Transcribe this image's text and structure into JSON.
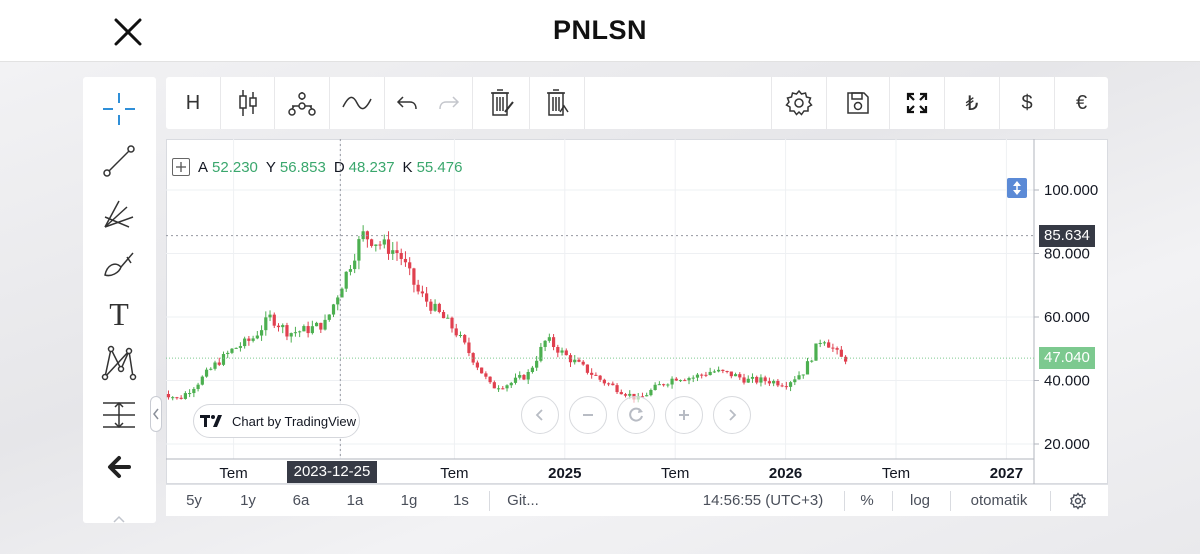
{
  "header": {
    "title": "PNLSN"
  },
  "toolbar": {
    "interval_label": "H",
    "icons": [
      "candles-icon",
      "indicators-icon",
      "compare-icon",
      "undo-icon",
      "redo-icon",
      "delete-drawings-icon",
      "delete-indicators-icon",
      "settings-icon",
      "save-icon",
      "fullscreen-icon",
      "lira-icon",
      "dollar-icon",
      "euro-icon"
    ],
    "lira": "₺",
    "dollar": "$",
    "euro": "€"
  },
  "left_tools": [
    "crosshair-icon",
    "trend-line-icon",
    "fib-icon",
    "brush-icon",
    "text-icon",
    "pattern-icon",
    "measure-icon",
    "back-arrow-icon"
  ],
  "left_tools_text": "T",
  "legend": {
    "a_label": "A",
    "a_value": "52.230",
    "y_label": "Y",
    "y_value": "56.853",
    "d_label": "D",
    "d_value": "48.237",
    "k_label": "K",
    "k_value": "55.476"
  },
  "badge": {
    "text": "Chart by TradingView"
  },
  "crosshair": {
    "date_label": "2023-12-25",
    "price": 85.634,
    "price_label": "85.634"
  },
  "last_price": {
    "value": 47.04,
    "label": "47.040"
  },
  "bottom_bar": {
    "ranges": [
      "5y",
      "1y",
      "6a",
      "1a",
      "1g",
      "1s"
    ],
    "goto": "Git...",
    "time": "14:56:55 (UTC+3)",
    "percent": "%",
    "log": "log",
    "auto": "otomatik"
  },
  "colors": {
    "up": "#4caf50",
    "down": "#e0404f",
    "crosshair_tag": "#363a45",
    "last_price_tag": "#7cc98f"
  },
  "chart_data": {
    "type": "candlestick",
    "title": "",
    "y_ticks": [
      "100.000",
      "80.000",
      "60.000",
      "40.000",
      "20.000"
    ],
    "y_tick_values": [
      100,
      80,
      60,
      40,
      20
    ],
    "x_ticks": [
      "Tem",
      "2023-12-25",
      "Tem",
      "2025",
      "Tem",
      "2026",
      "Tem",
      "2027"
    ],
    "x_tick_bold": [
      false,
      false,
      false,
      true,
      false,
      true,
      false,
      true
    ],
    "x_tick_values": [
      "2023-07",
      "2023-12-25",
      "2024-07",
      "2025-01",
      "2025-07",
      "2026-01",
      "2026-07",
      "2027-01"
    ],
    "xlim": [
      "2023-03",
      "2027-02"
    ],
    "ylim": [
      17,
      116
    ],
    "series_close_approx": [
      {
        "date": "2023-03",
        "close": 37
      },
      {
        "date": "2023-04",
        "close": 34
      },
      {
        "date": "2023-05",
        "close": 39
      },
      {
        "date": "2023-06",
        "close": 45
      },
      {
        "date": "2023-07",
        "close": 50
      },
      {
        "date": "2023-08",
        "close": 53
      },
      {
        "date": "2023-09",
        "close": 60
      },
      {
        "date": "2023-10",
        "close": 55
      },
      {
        "date": "2023-11",
        "close": 56
      },
      {
        "date": "2023-12",
        "close": 58
      },
      {
        "date": "2024-01",
        "close": 72
      },
      {
        "date": "2024-02",
        "close": 86
      },
      {
        "date": "2024-03",
        "close": 83
      },
      {
        "date": "2024-04",
        "close": 80
      },
      {
        "date": "2024-05",
        "close": 68
      },
      {
        "date": "2024-06",
        "close": 62
      },
      {
        "date": "2024-07",
        "close": 56
      },
      {
        "date": "2024-08",
        "close": 47
      },
      {
        "date": "2024-09",
        "close": 38
      },
      {
        "date": "2024-10",
        "close": 39
      },
      {
        "date": "2024-11",
        "close": 42
      },
      {
        "date": "2024-12",
        "close": 53
      },
      {
        "date": "2025-01",
        "close": 48
      },
      {
        "date": "2025-02",
        "close": 44
      },
      {
        "date": "2025-03",
        "close": 40
      },
      {
        "date": "2025-04",
        "close": 37
      },
      {
        "date": "2025-05",
        "close": 34
      },
      {
        "date": "2025-06",
        "close": 38
      },
      {
        "date": "2025-07",
        "close": 41
      },
      {
        "date": "2025-08",
        "close": 41
      },
      {
        "date": "2025-09",
        "close": 43
      },
      {
        "date": "2025-10",
        "close": 42
      },
      {
        "date": "2025-11",
        "close": 40
      },
      {
        "date": "2025-12",
        "close": 40
      },
      {
        "date": "2026-01",
        "close": 39
      },
      {
        "date": "2026-02",
        "close": 43
      },
      {
        "date": "2026-03",
        "close": 54
      },
      {
        "date": "2026-04",
        "close": 47
      }
    ],
    "grid": true
  }
}
